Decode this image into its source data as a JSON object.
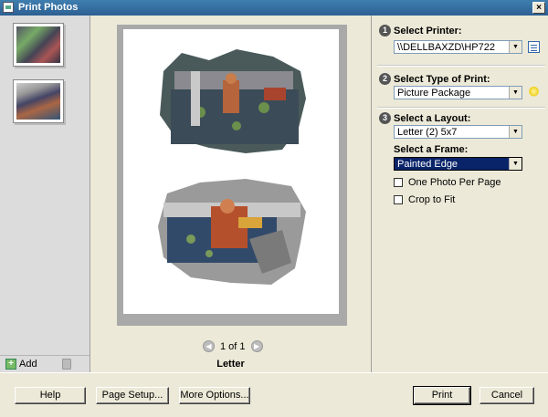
{
  "window": {
    "title": "Print Photos",
    "close_label": "×"
  },
  "left_panel": {
    "add_label": "Add"
  },
  "preview": {
    "pager_text": "1 of 1",
    "prev_arrow": "◀",
    "next_arrow": "▶",
    "page_size": "Letter"
  },
  "settings": {
    "step1": {
      "number": "1",
      "label": "Select Printer:",
      "value": "\\\\DELLBAXZD\\HP722"
    },
    "step2": {
      "number": "2",
      "label": "Select Type of Print:",
      "value": "Picture Package"
    },
    "step3": {
      "number": "3",
      "label": "Select a Layout:",
      "value": "Letter (2) 5x7"
    },
    "frame": {
      "label": "Select a Frame:",
      "value": "Painted Edge"
    },
    "one_photo_per_page": {
      "label": "One Photo Per Page",
      "checked": false
    },
    "crop_to_fit": {
      "label": "Crop to Fit",
      "checked": false
    },
    "dropdown_arrow": "▼"
  },
  "buttons": {
    "help": "Help",
    "page_setup": "Page Setup...",
    "more_options": "More Options...",
    "print": "Print",
    "cancel": "Cancel"
  }
}
